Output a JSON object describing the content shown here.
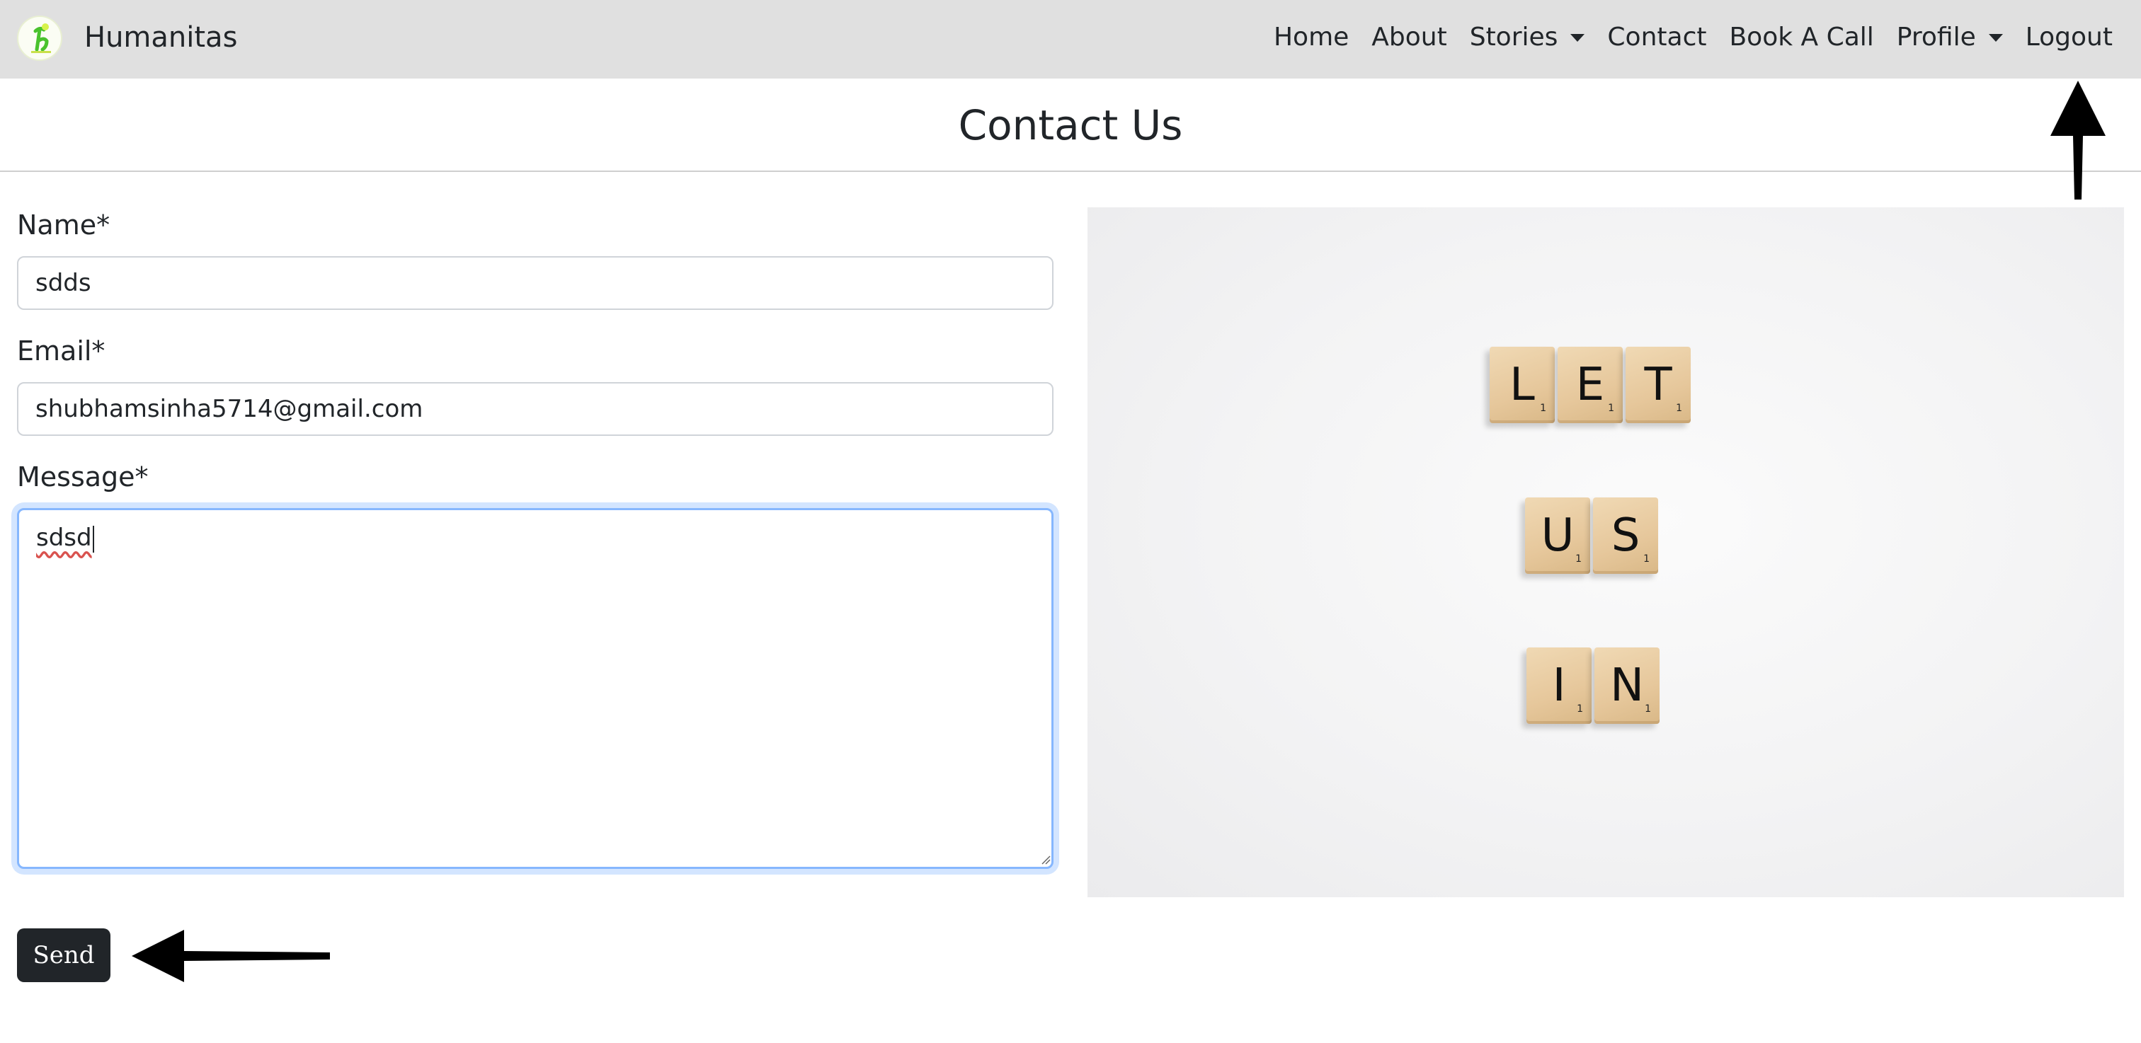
{
  "navbar": {
    "brand": "Humanitas",
    "links": [
      {
        "label": "Home",
        "dropdown": false
      },
      {
        "label": "About",
        "dropdown": false
      },
      {
        "label": "Stories",
        "dropdown": true
      },
      {
        "label": "Contact",
        "dropdown": false
      },
      {
        "label": "Book A Call",
        "dropdown": false
      },
      {
        "label": "Profile",
        "dropdown": true
      },
      {
        "label": "Logout",
        "dropdown": false
      }
    ]
  },
  "page": {
    "title": "Contact Us"
  },
  "form": {
    "name_label": "Name*",
    "name_value": "sdds",
    "email_label": "Email*",
    "email_value": "shubhamsinha5714@gmail.com",
    "message_label": "Message*",
    "message_value": "sdsd",
    "send_label": "Send"
  },
  "image": {
    "tiles": [
      [
        {
          "letter": "L",
          "score": "1"
        },
        {
          "letter": "E",
          "score": "1"
        },
        {
          "letter": "T",
          "score": "1"
        }
      ],
      [
        {
          "letter": "U",
          "score": "1"
        },
        {
          "letter": "S",
          "score": "1"
        }
      ],
      [
        {
          "letter": "I",
          "score": "1"
        },
        {
          "letter": "N",
          "score": "1"
        }
      ]
    ]
  },
  "colors": {
    "navbar_bg": "#e0e0e0",
    "button_bg": "#212529",
    "focus_border": "#86b7fe",
    "text": "#212529"
  },
  "icons": {
    "brand_logo": "humanitas-logo-icon",
    "dropdown": "caret-down-icon",
    "annotation": "black-arrow-icon"
  }
}
